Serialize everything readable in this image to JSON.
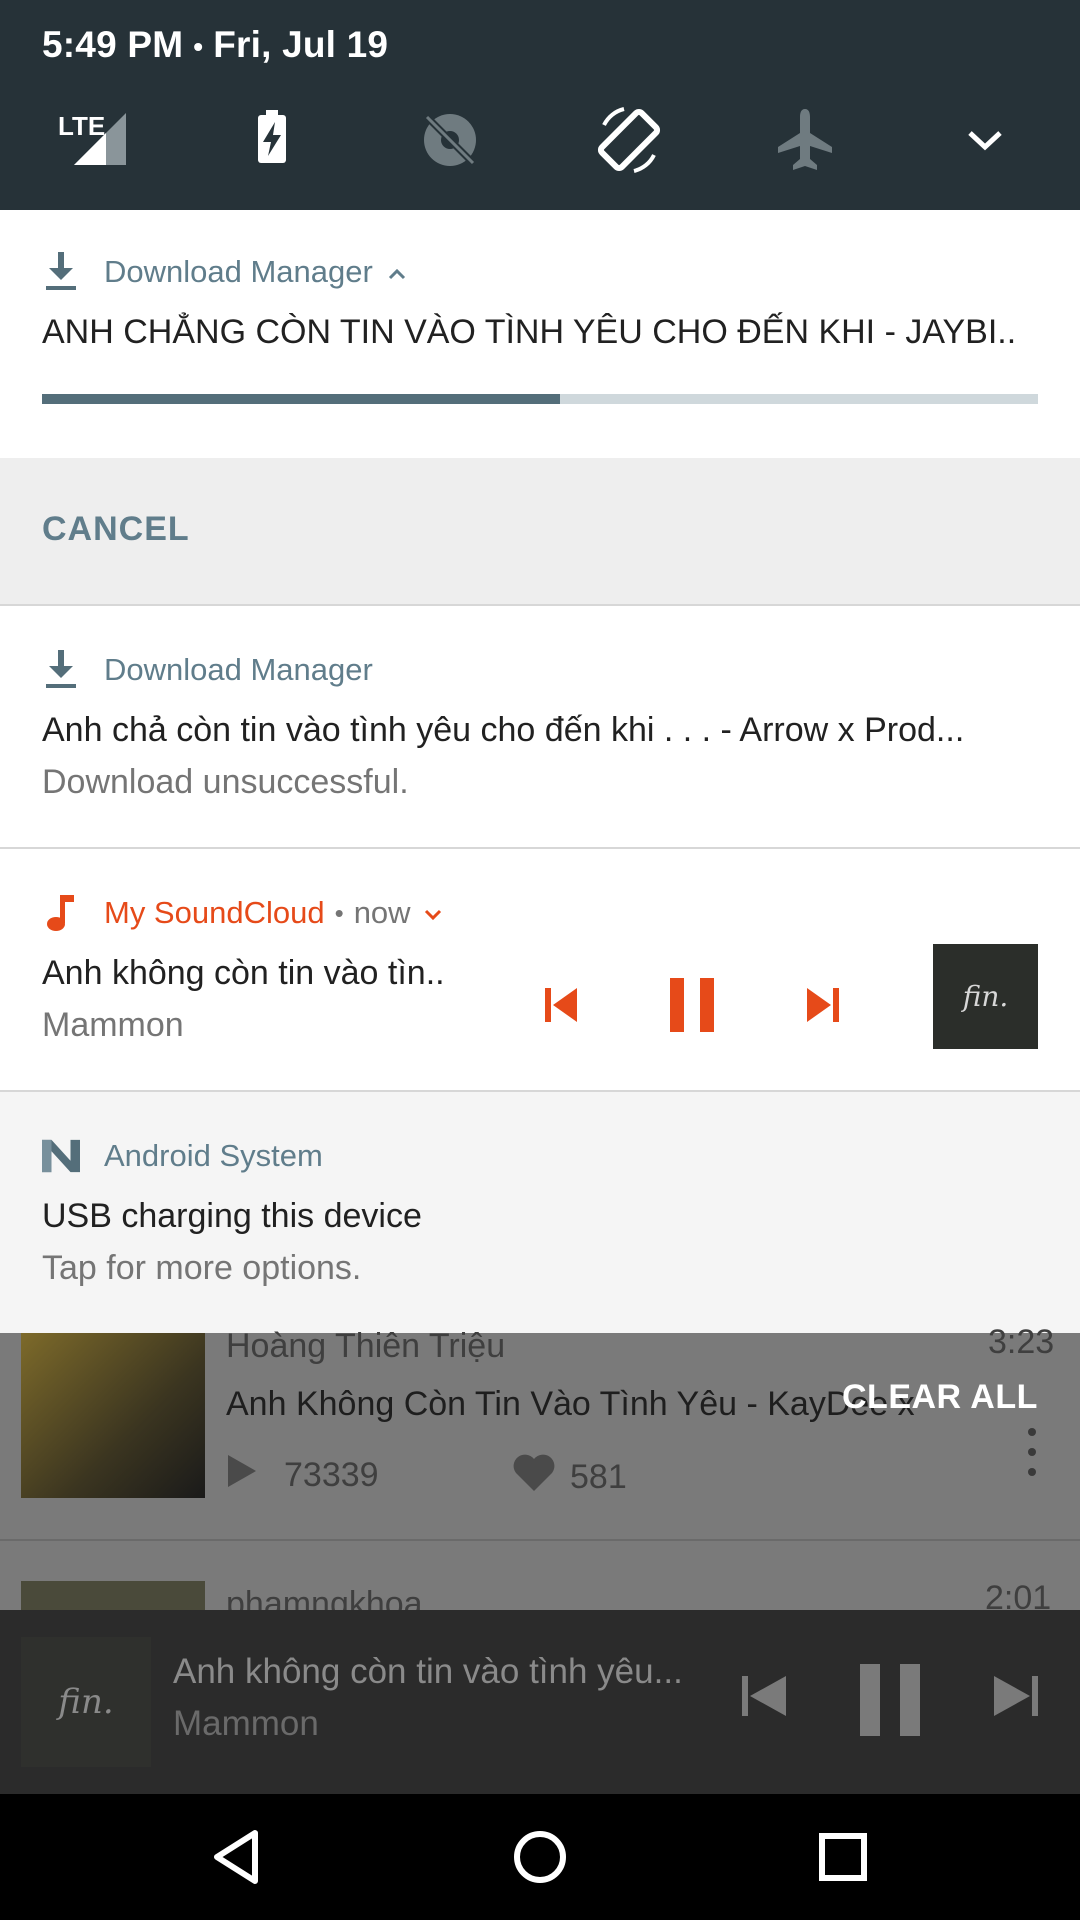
{
  "status_bar": {
    "time": "5:49 PM",
    "separator": "•",
    "date": "Fri, Jul 19",
    "network": "LTE"
  },
  "quick_settings": {
    "tiles": [
      "signal-icon",
      "battery-charging-icon",
      "location-off-icon",
      "auto-rotate-icon",
      "airplane-mode-icon",
      "expand-icon"
    ]
  },
  "notifications": [
    {
      "app_name": "Download Manager",
      "title": "ANH CHẲNG CÒN TIN VÀO TÌNH YÊU CHO ĐẾN KHI - JAYBI..",
      "progress": 0.52,
      "action": "CANCEL"
    },
    {
      "app_name": "Download Manager",
      "title": "Anh chả còn tin vào tình yêu cho đến khi . . . - Arrow x Prod...",
      "subtitle": "Download unsuccessful."
    },
    {
      "app_name": "My SoundCloud",
      "separator": "•",
      "time": "now",
      "title": "Anh không còn tin vào tìn..",
      "subtitle": "Mammon",
      "album_art_text": "fin."
    },
    {
      "app_name": "Android System",
      "title": "USB charging this device",
      "subtitle": "Tap for more options."
    }
  ],
  "background_app": {
    "artist": "Hoàng Thiên Triệu",
    "track": "Anh Không Còn Tin Vào Tình Yêu - KayDee x",
    "duration": "3:23",
    "plays": "73339",
    "likes": "581",
    "next_artist": "phamngkhoa",
    "next_duration": "2:01"
  },
  "clear_all": "CLEAR ALL",
  "mini_player": {
    "art_text": "fin.",
    "title": "Anh không còn tin vào tình yêu...",
    "artist": "Mammon"
  },
  "colors": {
    "accent_orange": "#e64a19",
    "download_blue": "#546e7a",
    "app_label": "#607d8b"
  }
}
